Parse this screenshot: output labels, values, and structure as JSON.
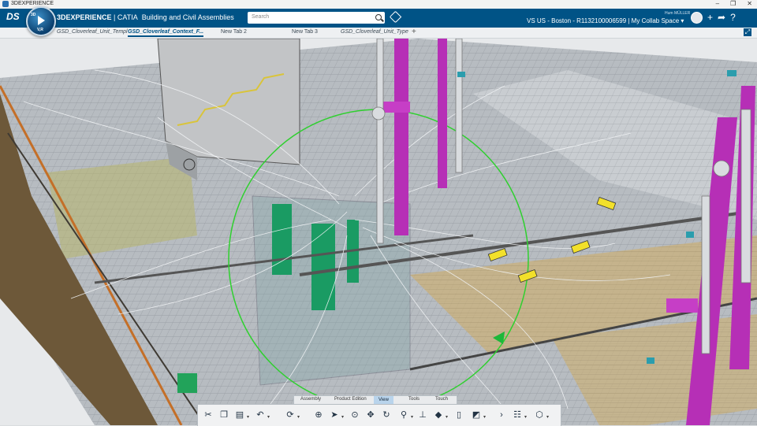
{
  "titlebar": {
    "title": "3DEXPERIENCE"
  },
  "compass": {
    "top_label": "3D",
    "bottom_label": "V,R"
  },
  "header": {
    "brand_bold": "3DEXPERIENCE",
    "brand_rest": " | CATIA",
    "app_name": "Building and Civil Assemblies",
    "search_placeholder": "Search",
    "context": "VS US - Boston - R1132100006599 | My Collab Space",
    "user_name": "Hum MÜLLER"
  },
  "tabs": [
    {
      "label": "GSD_Cloverleaf_Unit_Templ"
    },
    {
      "label": "GSD_Cloverleaf_Context_F..."
    },
    {
      "label": "New Tab 2"
    },
    {
      "label": "New Tab 3"
    },
    {
      "label": "GSD_Cloverleaf_Unit_Type"
    }
  ],
  "tab_add": "+",
  "action_bar_tabs": [
    "Assembly",
    "Product Edition",
    "View",
    "Tools",
    "Touch"
  ],
  "active_action_tab": "View",
  "toolbar_icons": [
    "cut-icon",
    "copy-icon",
    "paste-icon",
    "undo-icon",
    "update-icon",
    "zoom-icon",
    "select-icon",
    "center-icon",
    "pan-icon",
    "rotate-icon",
    "zoom-area-icon",
    "normal-view-icon",
    "render-style-icon",
    "cylinder-icon",
    "cube-view-icon",
    "layout-icon",
    "next-icon",
    "tree-icon",
    "capture-icon"
  ],
  "colors": {
    "topbar": "#005386",
    "pipe": "#b62fb6",
    "selection_circle": "#2fd02f",
    "equipment": "#1a9b63",
    "marker": "#f2e02a"
  }
}
